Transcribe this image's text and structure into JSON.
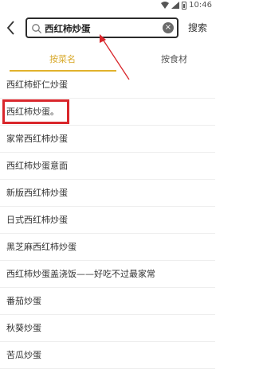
{
  "status_bar": {
    "time": "10:46",
    "icons": [
      "wifi-icon",
      "signal-icon",
      "battery-icon"
    ]
  },
  "header": {
    "back_icon": "chevron-left-icon",
    "search": {
      "value": "西红柿炒蛋",
      "icon": "search-icon",
      "clear_icon": "clear-icon"
    },
    "search_button": "搜索"
  },
  "tabs": [
    {
      "label": "按菜名",
      "active": true
    },
    {
      "label": "按食材",
      "active": false
    }
  ],
  "results": [
    "西红柿虾仁炒蛋",
    "西红柿炒蛋。",
    "家常西红柿炒蛋",
    "西红柿炒蛋意面",
    "新版西红柿炒蛋",
    "日式西红柿炒蛋",
    "黑芝麻西红柿炒蛋",
    "西红柿炒蛋盖浇饭——好吃不过最家常",
    "番茄炒蛋",
    "秋葵炒蛋",
    "苦瓜炒蛋"
  ],
  "colors": {
    "accent": "#e1b22c",
    "annotation": "#d9262b"
  }
}
